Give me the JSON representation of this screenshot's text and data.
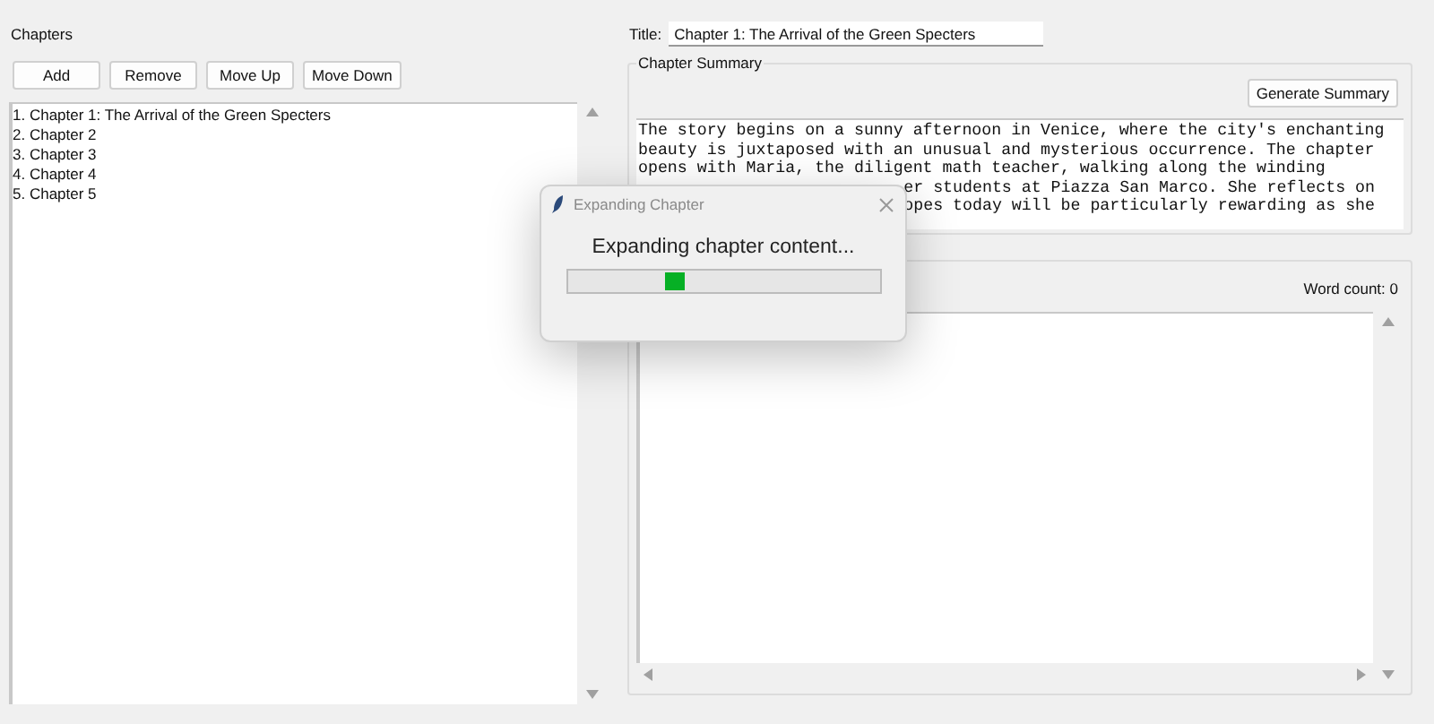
{
  "chapters_panel": {
    "label": "Chapters",
    "buttons": [
      "Add",
      "Remove",
      "Move Up",
      "Move Down"
    ],
    "chapters": [
      {
        "text": "1. Chapter 1: The Arrival of the Green Specters",
        "selected": false
      },
      {
        "text": "2. Chapter 2",
        "selected": false
      },
      {
        "text": "3. Chapter 3",
        "selected": false
      },
      {
        "text": "4. Chapter 4",
        "selected": false
      },
      {
        "text": "5. Chapter 5",
        "selected": false
      }
    ]
  },
  "title_field": {
    "label": "Title:",
    "value": "Chapter 1: The Arrival of the Green Specters"
  },
  "summary_frame": {
    "label": "Chapter Summary",
    "button": "Generate Summary",
    "lines": [
      {
        "kind": "full",
        "text": "The story begins on a sunny afternoon in Venice, where the city's enchanting"
      },
      {
        "kind": "full",
        "text": "beauty is juxtaposed with an unusual and mysterious occurrence. The chapter"
      },
      {
        "kind": "full",
        "text": "opens with Maria, the diligent math teacher, walking along the winding"
      },
      {
        "kind": "partial",
        "text": "er students at Piazza San Marco. She reflects on"
      },
      {
        "kind": "partial",
        "text": "opes today will be particularly rewarding as she"
      }
    ]
  },
  "content_frame": {
    "word_count": "Word count: 0"
  },
  "dialog": {
    "title": "Expanding Chapter",
    "message": "Expanding chapter content...",
    "level": 0.375
  }
}
